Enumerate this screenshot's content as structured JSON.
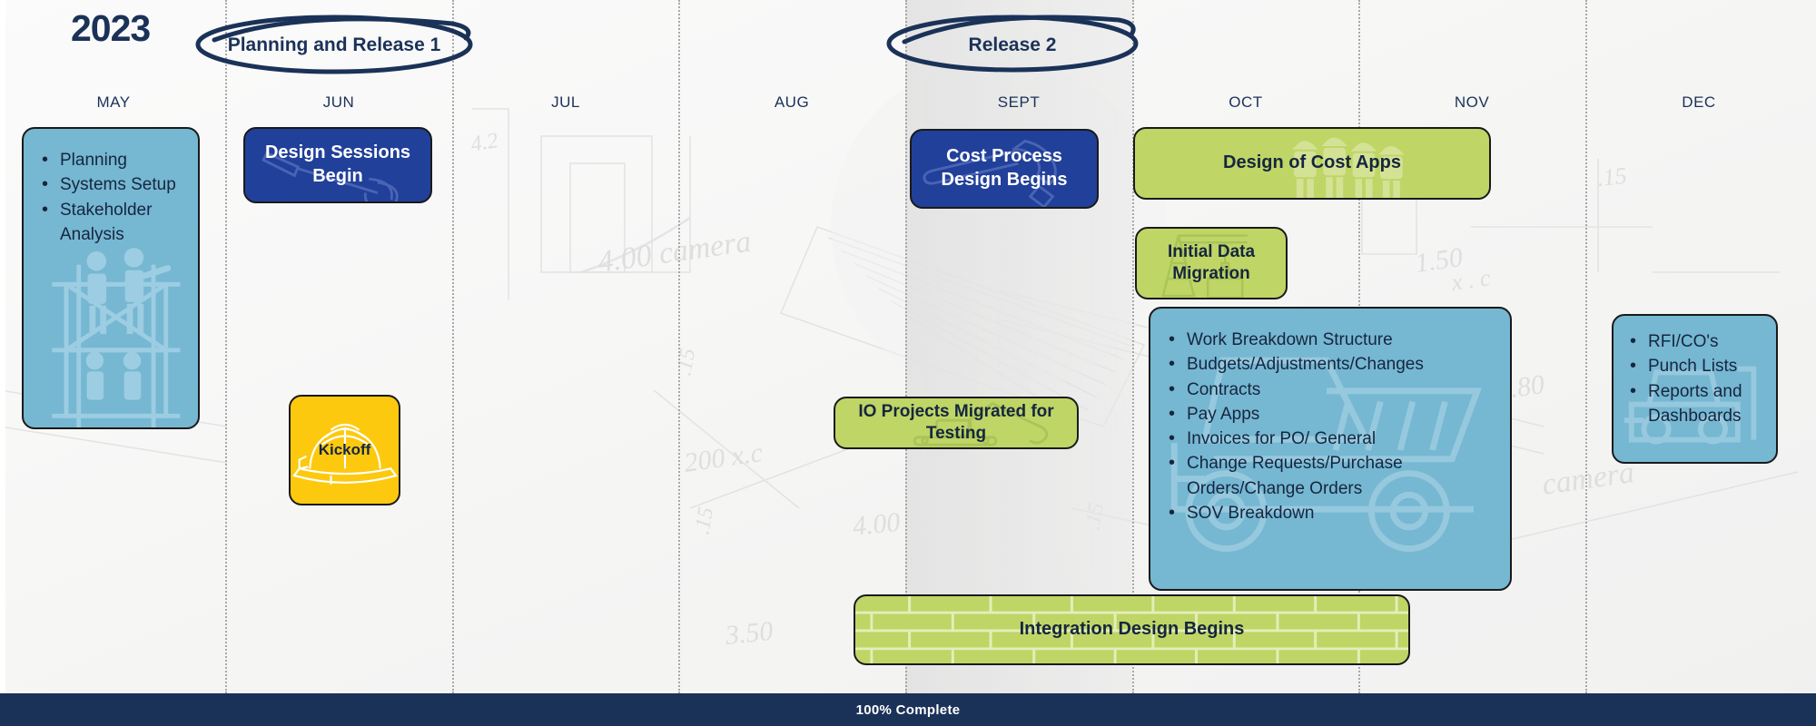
{
  "header": {
    "year": "2023",
    "phases": [
      {
        "label": "Planning and Release 1"
      },
      {
        "label": "Release 2"
      }
    ]
  },
  "timeline": {
    "months": [
      "MAY",
      "JUN",
      "JUL",
      "AUG",
      "SEPT",
      "OCT",
      "NOV",
      "DEC"
    ]
  },
  "cards": {
    "may_tasks": {
      "items": [
        "Planning",
        "Systems Setup",
        "Stakeholder",
        "Analysis"
      ],
      "color": "#76b7d2"
    },
    "design_sessions": {
      "label": "Design Sessions Begin",
      "color": "#21409a",
      "icon": "shovel-icon"
    },
    "kickoff": {
      "label": "Kickoff",
      "color": "#fdc90f",
      "icon": "hard-hat-icon"
    },
    "io_projects": {
      "label": "IO Projects Migrated for Testing",
      "color": "#bfd566",
      "icon": "excavator-icon"
    },
    "cost_process": {
      "label": "Cost Process Design Begins",
      "color": "#21409a",
      "icon": "hammer-icon"
    },
    "design_cost_apps": {
      "label": "Design of Cost Apps",
      "color": "#bfd566",
      "icon": "workers-icon"
    },
    "initial_data_migration": {
      "label": "Initial Data Migration",
      "color": "#bfd566",
      "icon": "crane-icon"
    },
    "cost_features": {
      "items": [
        "Work Breakdown Structure",
        "Budgets/Adjustments/Changes",
        "Contracts",
        "Pay Apps",
        "Invoices for PO/ General",
        "Change Requests/Purchase",
        "Orders/Change Orders",
        "SOV Breakdown"
      ],
      "color": "#76b7d2",
      "icon": "dump-truck-icon"
    },
    "integration_design": {
      "label": "Integration Design Begins",
      "color": "#bfd566",
      "icon": "brick-wall-icon"
    },
    "dec_tasks": {
      "items": [
        "RFI/CO's",
        "Punch Lists",
        "Reports and",
        "Dashboards"
      ],
      "color": "#76b7d2",
      "icon": "bulldozer-icon"
    }
  },
  "footer": {
    "progress_label": "100% Complete",
    "background": "#1b3258"
  }
}
